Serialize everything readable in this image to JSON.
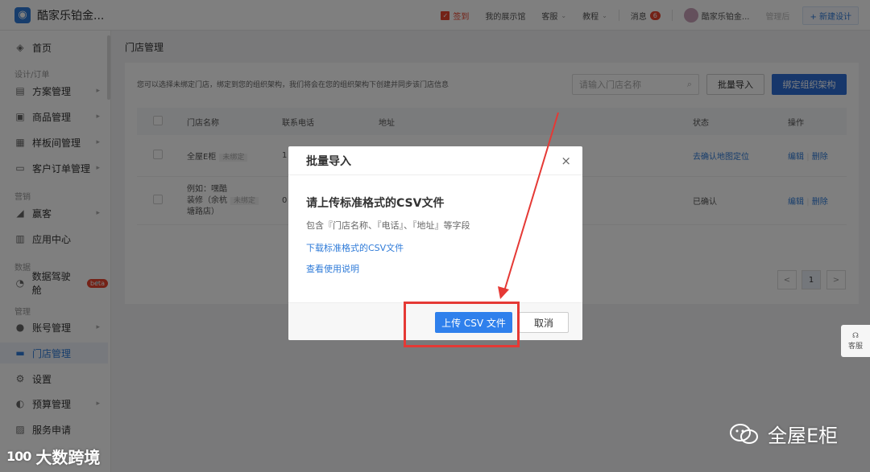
{
  "topbar": {
    "brand": "酷家乐铂金...",
    "checkin": "签到",
    "showroom": "我的展示馆",
    "service": "客服",
    "tutorial": "教程",
    "messages": "消息",
    "message_count": "6",
    "user": "酷家乐铂金...",
    "manage": "管理后",
    "new_design": "+ 新建设计"
  },
  "sidebar": {
    "home": "首页",
    "group_design": "设计/订单",
    "plan": "方案管理",
    "goods": "商品管理",
    "sample": "样板间管理",
    "orders": "客户订单管理",
    "group_marketing": "营销",
    "guest": "赢客",
    "apps": "应用中心",
    "group_data": "数据",
    "cockpit": "数据驾驶舱",
    "beta": "beta",
    "group_manage": "管理",
    "accounts": "账号管理",
    "stores": "门店管理",
    "settings": "设置",
    "budget": "预算管理",
    "service_apply": "服务申请"
  },
  "page": {
    "title": "门店管理",
    "hint": "您可以选择未绑定门店，绑定到您的组织架构，我们将会在您的组织架构下创建并同步该门店信息",
    "search_placeholder": "请输入门店名称",
    "import_button": "批量导入",
    "bind_button": "绑定组织架构"
  },
  "table": {
    "headers": {
      "name": "门店名称",
      "phone": "联系电话",
      "address": "地址",
      "status": "状态",
      "ops": "操作"
    },
    "rows": [
      {
        "name": "全屋E柜",
        "tag": "未绑定",
        "phone": "1",
        "status": "去确认地图定位",
        "edit": "编辑",
        "delete": "删除"
      },
      {
        "name_line1": "例如：嘿酷",
        "name_line2": "装修（余杭",
        "name_line3": "塘路店）",
        "tag": "未绑定",
        "phone": "0",
        "status": "已确认",
        "edit": "编辑",
        "delete": "删除"
      }
    ],
    "page_prev": "<",
    "page_current": "1",
    "page_next": ">"
  },
  "modal": {
    "title": "批量导入",
    "close": "×",
    "heading": "请上传标准格式的CSV文件",
    "desc": "包含『门店名称、『电话』、『地址』等字段",
    "download_link": "下载标准格式的CSV文件",
    "help_link": "查看使用说明",
    "upload_button": "上传 CSV 文件",
    "cancel_button": "取消"
  },
  "float_service": "客服",
  "watermarks": {
    "left_logo": "100",
    "left_text": "大数跨境",
    "right_text": "全屋E柜"
  },
  "colors": {
    "primary": "#2f80ec",
    "annotation": "#e53935",
    "danger": "#e8442e"
  }
}
